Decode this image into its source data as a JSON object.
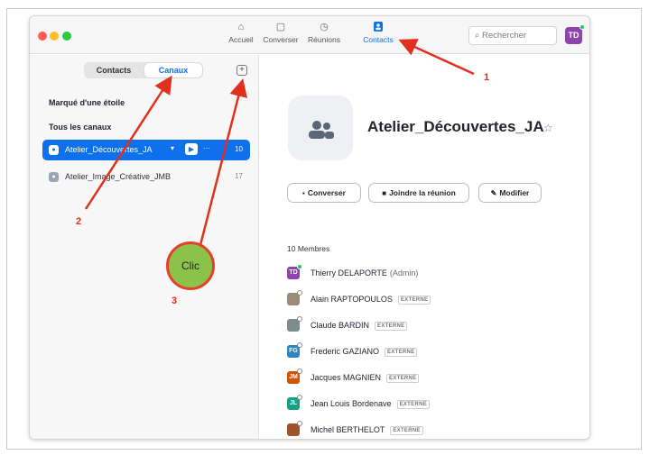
{
  "titlebar": {
    "nav": [
      {
        "label": "Accueil",
        "icon": "home-icon"
      },
      {
        "label": "Converser",
        "icon": "chat-icon"
      },
      {
        "label": "Réunions",
        "icon": "clock-icon"
      },
      {
        "label": "Contacts",
        "icon": "contacts-icon",
        "active": true
      }
    ],
    "search_placeholder": "Rechercher",
    "user_initials": "TD"
  },
  "sidebar": {
    "tabs": [
      "Contacts",
      "Canaux"
    ],
    "active_tab": "Canaux",
    "sections": [
      "Marqué d'une étoile",
      "Tous les canaux"
    ],
    "channels": [
      {
        "name": "Atelier_Découvertes_JA",
        "count": "10",
        "selected": true
      },
      {
        "name": "Atelier_Image_Créative_JMB",
        "count": "17",
        "selected": false
      }
    ]
  },
  "main": {
    "channel_title": "Atelier_Découvertes_JA",
    "buttons": {
      "chat": "Converser",
      "join": "Joindre la réunion",
      "edit": "Modifier"
    },
    "members_header": "10 Membres",
    "members": [
      {
        "initials": "TD",
        "color": "#8e44ad",
        "name": "Thierry DELAPORTE",
        "extra": "(Admin)",
        "tag": "",
        "online": true
      },
      {
        "initials": "",
        "color": "#9b8b7a",
        "name": "Alain RAPTOPOULOS",
        "extra": "",
        "tag": "EXTERNE",
        "online": false
      },
      {
        "initials": "",
        "color": "#7f8c8d",
        "name": "Claude BARDIN",
        "extra": "",
        "tag": "EXTERNE",
        "online": false
      },
      {
        "initials": "FG",
        "color": "#2e86c1",
        "name": "Frederic GAZIANO",
        "extra": "",
        "tag": "EXTERNE",
        "online": false
      },
      {
        "initials": "JM",
        "color": "#d35400",
        "name": "Jacques MAGNIEN",
        "extra": "",
        "tag": "EXTERNE",
        "online": false
      },
      {
        "initials": "JL",
        "color": "#16a085",
        "name": "Jean Louis Bordenave",
        "extra": "",
        "tag": "EXTERNE",
        "online": false
      },
      {
        "initials": "",
        "color": "#a0522d",
        "name": "Michel BERTHELOT",
        "extra": "",
        "tag": "EXTERNE",
        "online": false
      }
    ]
  },
  "annotations": {
    "n1": "1",
    "n2": "2",
    "n3": "3",
    "clic": "Clic",
    "arrow_color": "#e0301e"
  }
}
